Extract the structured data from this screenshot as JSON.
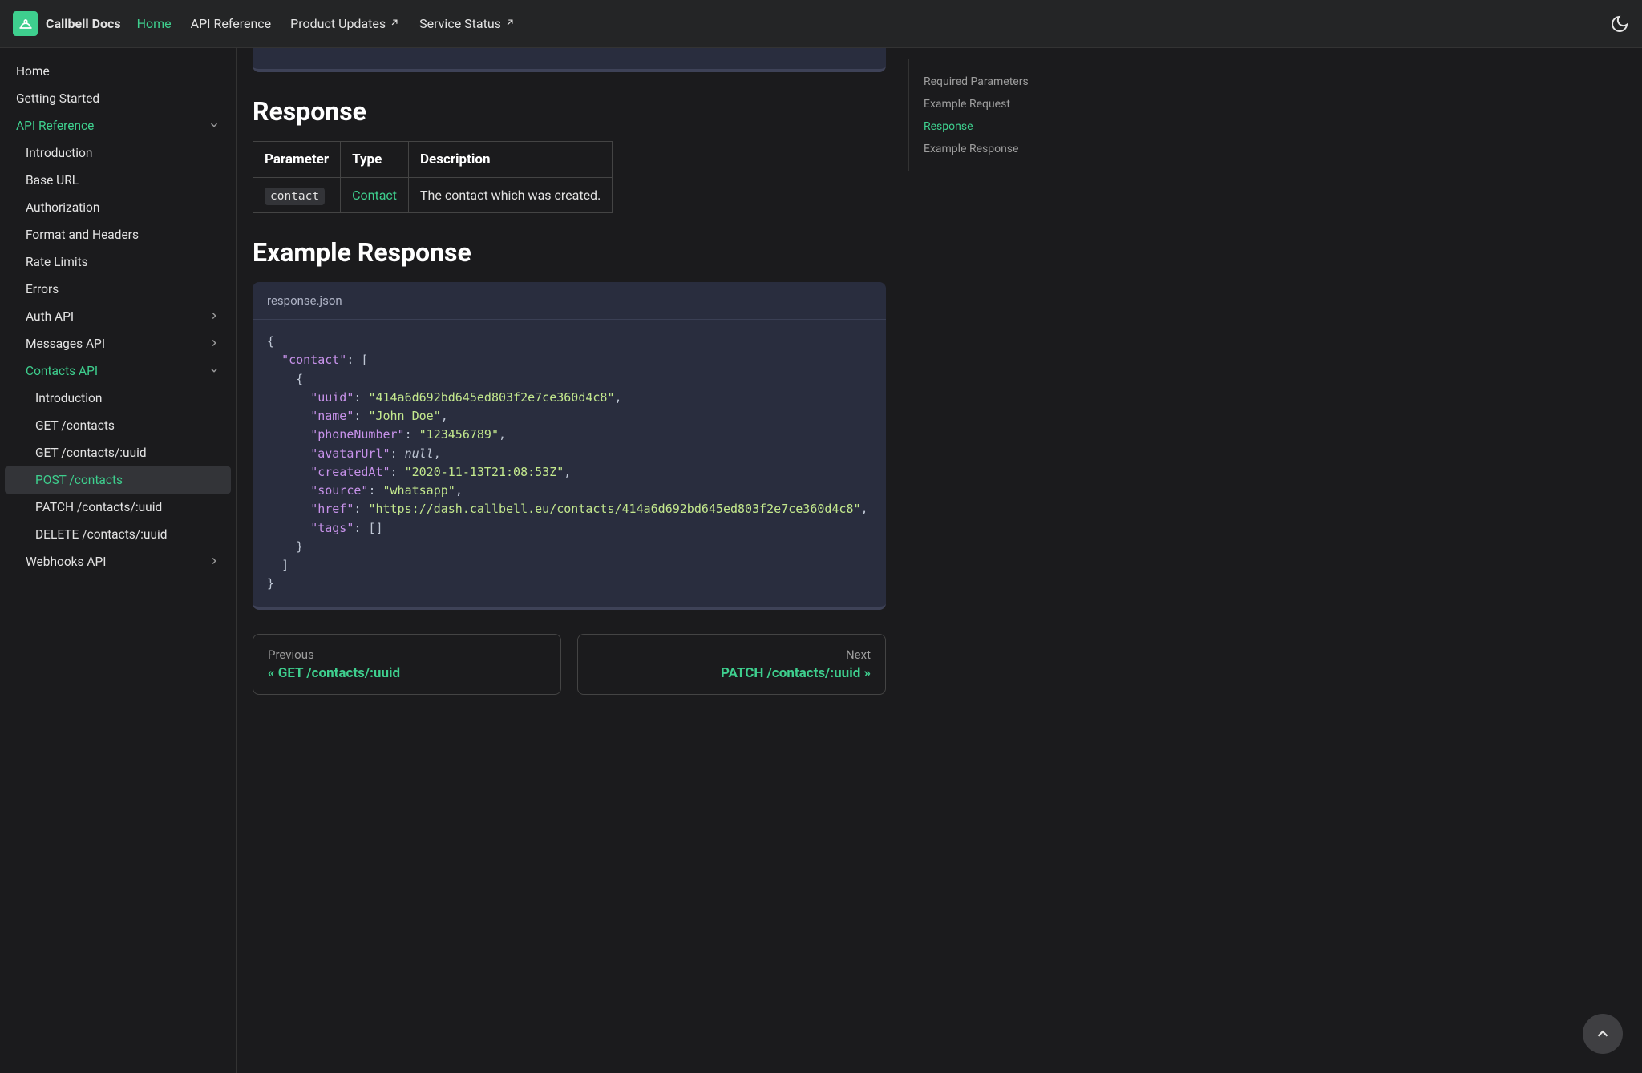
{
  "brand": "Callbell Docs",
  "nav": {
    "home": "Home",
    "api_reference": "API Reference",
    "product_updates": "Product Updates",
    "service_status": "Service Status"
  },
  "sidebar": {
    "home": "Home",
    "getting_started": "Getting Started",
    "api_reference": "API Reference",
    "introduction": "Introduction",
    "base_url": "Base URL",
    "authorization": "Authorization",
    "format_headers": "Format and Headers",
    "rate_limits": "Rate Limits",
    "errors": "Errors",
    "auth_api": "Auth API",
    "messages_api": "Messages API",
    "contacts_api": "Contacts API",
    "contacts_intro": "Introduction",
    "get_contacts": "GET /contacts",
    "get_contact_uuid": "GET /contacts/:uuid",
    "post_contacts": "POST /contacts",
    "patch_contact": "PATCH /contacts/:uuid",
    "delete_contact": "DELETE /contacts/:uuid",
    "webhooks_api": "Webhooks API"
  },
  "headings": {
    "response": "Response",
    "example_response": "Example Response"
  },
  "table": {
    "h_param": "Parameter",
    "h_type": "Type",
    "h_desc": "Description",
    "param": "contact",
    "type": "Contact",
    "desc": "The contact which was created."
  },
  "code": {
    "filename": "response.json",
    "uuid": "\"414a6d692bd645ed803f2e7ce360d4c8\"",
    "name": "\"John Doe\"",
    "phone": "\"123456789\"",
    "avatar": "null",
    "created": "\"2020-11-13T21:08:53Z\"",
    "source": "\"whatsapp\"",
    "href": "\"https://dash.callbell.eu/contacts/414a6d692bd645ed803f2e7ce360d4c8\""
  },
  "pagination": {
    "prev_label": "Previous",
    "prev_title": "« GET /contacts/:uuid",
    "next_label": "Next",
    "next_title": "PATCH /contacts/:uuid »"
  },
  "toc": {
    "required_params": "Required Parameters",
    "example_request": "Example Request",
    "response": "Response",
    "example_response": "Example Response"
  }
}
